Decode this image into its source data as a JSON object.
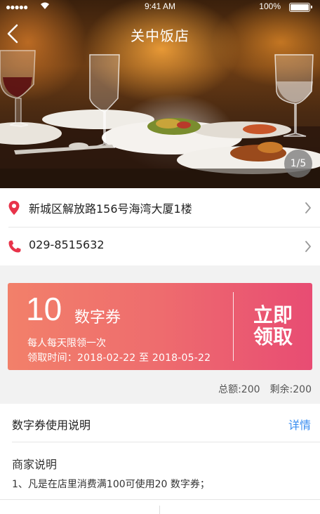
{
  "status_bar": {
    "signal": "●●●●●",
    "time": "9:41 AM",
    "battery": "100%"
  },
  "nav": {
    "title": "关中饭店",
    "page_indicator": "1/5"
  },
  "info": {
    "address": "新城区解放路156号海湾大厦1楼",
    "phone": "029-8515632"
  },
  "coupon": {
    "amount": "10",
    "type": "数字券",
    "limit": "每人每天限领一次",
    "claim_period": "领取时间：2018-02-22 至 2018-05-22",
    "claim_line1": "立即",
    "claim_line2": "领取"
  },
  "stats": {
    "total": "总额:200",
    "remaining": "剩余:200"
  },
  "instructions": {
    "title": "数字券使用说明",
    "detail_link": "详情",
    "merchant_heading": "商家说明",
    "rule_1": "1、凡是在店里消费满100可使用20 数字券；"
  },
  "colors": {
    "accent": "#e8334a",
    "coupon_start": "#f2806a",
    "coupon_end": "#e84c73",
    "link": "#3b8ef0"
  },
  "icons": {
    "back": "chevron-left-icon",
    "location": "location-pin-icon",
    "phone": "phone-icon",
    "chevron": "chevron-right-icon",
    "wifi": "wifi-icon",
    "battery": "battery-icon"
  }
}
